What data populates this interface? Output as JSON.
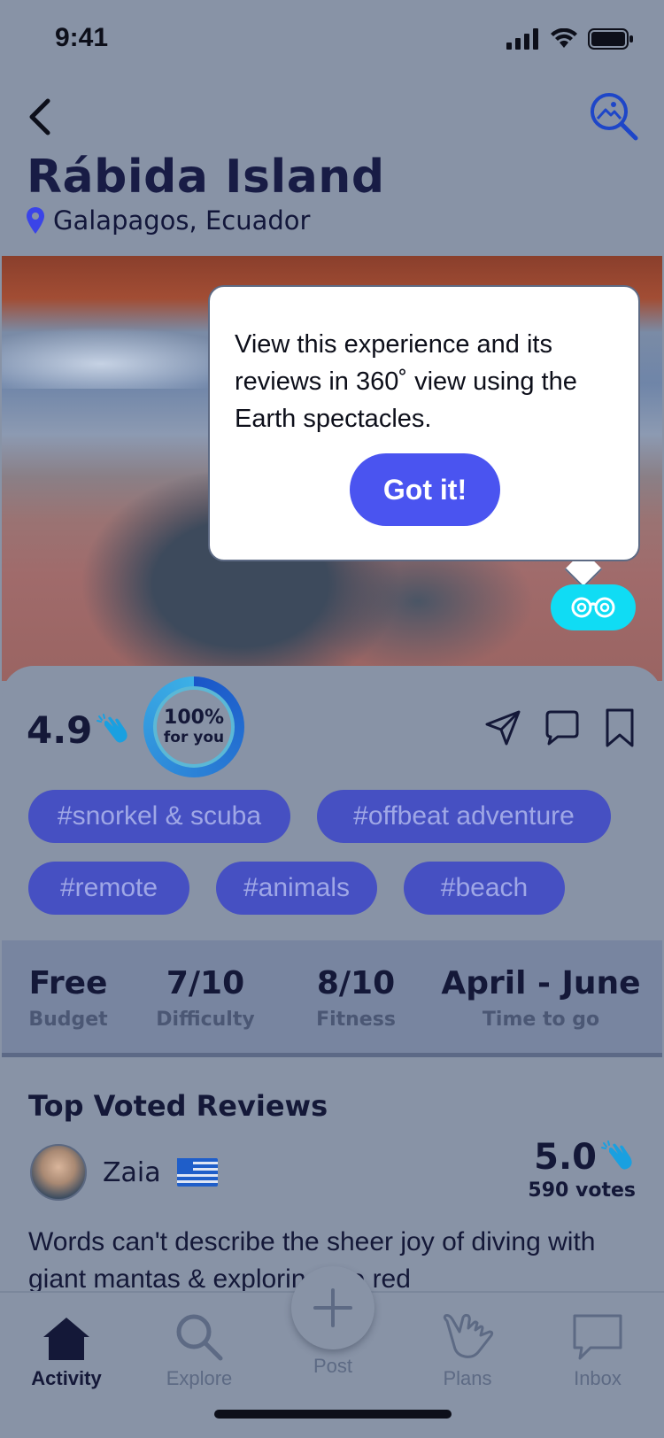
{
  "status": {
    "time": "9:41"
  },
  "header": {
    "title": "Rábida Island",
    "location": "Galapagos, Ecuador"
  },
  "popover": {
    "text": "View this experience and its reviews in 360˚ view using the Earth spectacles.",
    "button": "Got it!"
  },
  "summary": {
    "rating": "4.9",
    "match_percent": "100%",
    "match_label": "for you"
  },
  "tags": [
    "#snorkel & scuba",
    "#offbeat adventure",
    "#remote",
    "#animals",
    "#beach"
  ],
  "stats": [
    {
      "value": "Free",
      "label": "Budget"
    },
    {
      "value": "7/10",
      "label": "Difficulty"
    },
    {
      "value": "8/10",
      "label": "Fitness"
    },
    {
      "value": "April - June",
      "label": "Time to go"
    }
  ],
  "reviews": {
    "title": "Top Voted Reviews",
    "top": {
      "name": "Zaia",
      "score": "5.0",
      "votes": "590 votes",
      "text": "Words can't describe the sheer joy of diving with giant mantas & exploring the red"
    }
  },
  "tabbar": {
    "activity": "Activity",
    "explore": "Explore",
    "post": "Post",
    "plans": "Plans",
    "inbox": "Inbox"
  },
  "colors": {
    "accent": "#4a54f0",
    "tag_bg": "#4650c2",
    "spectacles": "#10dcf4",
    "clap": "#1aa0e0"
  }
}
